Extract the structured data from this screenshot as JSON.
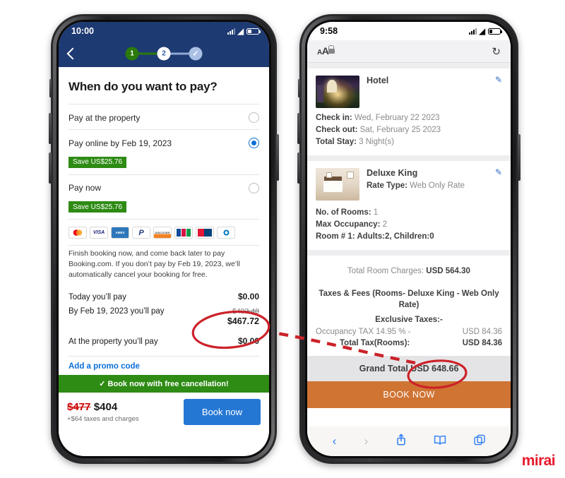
{
  "left_phone": {
    "status_bar": {
      "time": "10:00",
      "signal_icon": "cellular-icon",
      "wifi_icon": "wifi-icon",
      "battery_icon": "battery-icon"
    },
    "header": {
      "back_icon": "back-chevron-icon",
      "steps": [
        "1",
        "2",
        "✓"
      ]
    },
    "page_title": "When do you want to pay?",
    "options": [
      {
        "label": "Pay at the property",
        "selected": false,
        "badge": ""
      },
      {
        "label": "Pay online by Feb 19, 2023",
        "selected": true,
        "badge": "Save US$25.76"
      },
      {
        "label": "Pay now",
        "selected": false,
        "badge": "Save US$25.76"
      }
    ],
    "payment_cards": [
      "Mastercard",
      "VISA",
      "Amex",
      "PayPal",
      "Discover",
      "JCB",
      "UnionPay",
      "Diners Club"
    ],
    "legal_text": "Finish booking now, and come back later to pay Booking.com. If you don’t pay by Feb 19, 2023, we’ll automatically cancel your booking for free.",
    "pay_lines": [
      {
        "label": "Today you’ll pay",
        "amount": "$0.00",
        "old_amount": ""
      },
      {
        "label": "By Feb 19, 2023 you’ll pay",
        "amount": "$467.72",
        "old_amount": "$493.48"
      },
      {
        "label": "At the property you’ll pay",
        "amount": "$0.00",
        "old_amount": ""
      }
    ],
    "promo_link": "Add a promo code",
    "green_banner": "✓  Book now with free cancellation!",
    "footer": {
      "old_price": "$477",
      "new_price": "$404",
      "taxes_note": "+$64 taxes and charges",
      "book_button": "Book now"
    }
  },
  "right_phone": {
    "status_bar": {
      "time": "9:58",
      "signal_icon": "cellular-icon",
      "wifi_icon": "wifi-icon",
      "battery_icon": "battery-icon"
    },
    "safari_bar": {
      "text_size_icon": "aA",
      "lock_icon": "lock-icon",
      "reload_icon": "reload-icon"
    },
    "hotel_card": {
      "thumbnail": "hotel-exterior-thumbnail",
      "title": "Hotel",
      "edit_icon": "pencil-icon",
      "rows": [
        {
          "key": "Check in:",
          "value": "Wed, February 22 2023"
        },
        {
          "key": "Check out:",
          "value": "Sat, February 25 2023"
        },
        {
          "key": "Total Stay:",
          "value": "3 Night(s)"
        }
      ]
    },
    "room_card": {
      "thumbnail": "hotel-room-thumbnail",
      "title": "Deluxe King",
      "edit_icon": "pencil-icon",
      "rate_key": "Rate Type:",
      "rate_value": "Web Only Rate",
      "rows": [
        {
          "key": "No. of Rooms:",
          "value": "1"
        },
        {
          "key": "Max Occupancy:",
          "value": "2"
        },
        {
          "key": "Room # 1: Adults:2, Children:0",
          "value": ""
        }
      ]
    },
    "charges": {
      "room_charges_label": "Total Room Charges:",
      "room_charges_value": "USD 564.30",
      "taxes_heading": "Taxes & Fees (Rooms- Deluxe King - Web Only Rate)",
      "exclusive_label": "Exclusive Taxes:-",
      "tax_rows": [
        {
          "label": "Occupancy TAX 14.95 % -",
          "value": "USD 84.36"
        },
        {
          "label": "Total Tax(Rooms):",
          "value": "USD 84.36"
        }
      ],
      "grand_total_label": "Grand Total",
      "grand_total_value": "USD 648.66"
    },
    "book_now_button": "BOOK NOW",
    "toolbar": {
      "back_icon": "back-chevron-icon",
      "forward_icon": "forward-chevron-icon",
      "share_icon": "share-icon",
      "bookmarks_icon": "book-icon",
      "tabs_icon": "tabs-icon"
    }
  },
  "annotations": {
    "highlight_left": "$467.72",
    "highlight_right": "USD 648.66",
    "arrow": "dashed-red-arrow",
    "circle_color": "#cc2229"
  },
  "watermark": {
    "label": "mirai",
    "color": "#e8192c"
  }
}
